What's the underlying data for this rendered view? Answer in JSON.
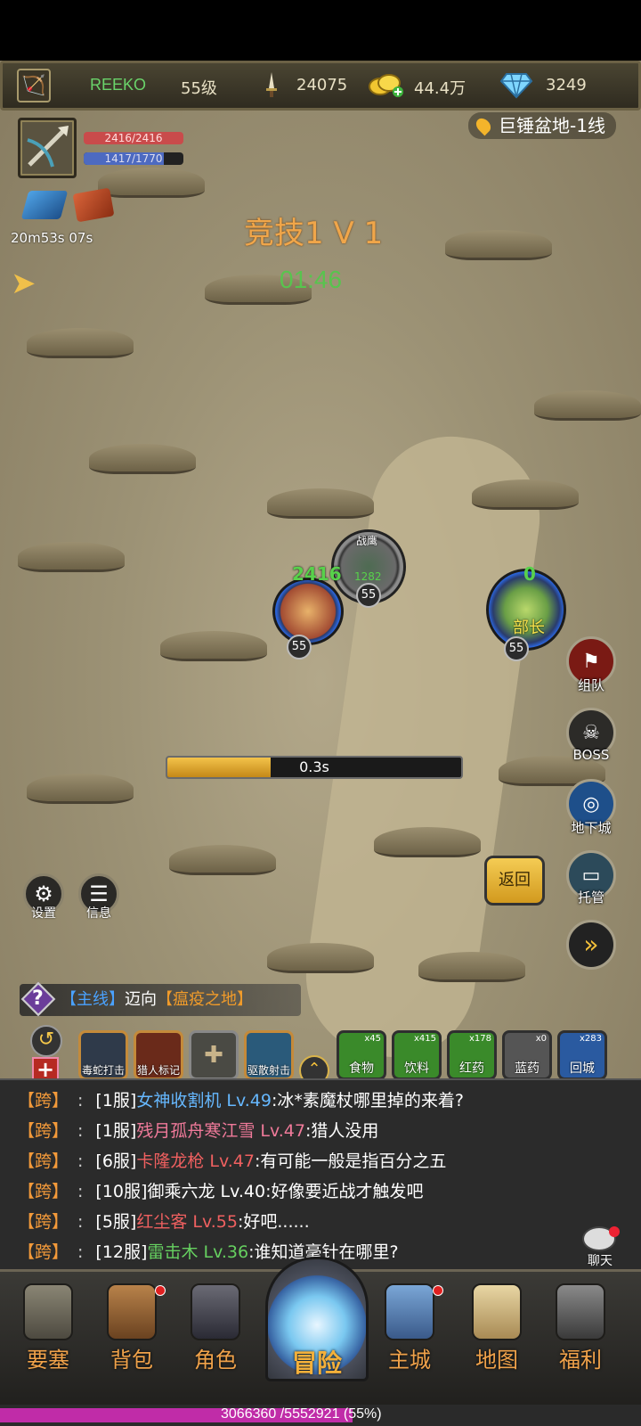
{
  "topbar": {
    "player_name": "REEKO",
    "level": "55级",
    "combat_power": "24075",
    "gold": "44.4万",
    "diamonds": "3249"
  },
  "player": {
    "hp": "2416/2416",
    "mp": "1417/1770",
    "mp_fraction": 0.8,
    "buff_timer": "20m53s 07s"
  },
  "location": "巨锤盆地-1线",
  "battle": {
    "mode_title": "竞技1 V 1",
    "countdown": "01:46",
    "player_hp_float": "2416",
    "player_level": "55",
    "pet_name": "战鹰",
    "pet_hp": "1282",
    "pet_level": "55",
    "enemy_hp_float": "0",
    "enemy_name": "部长",
    "enemy_level": "55",
    "cast_time": "0.3s",
    "cast_progress": 0.35
  },
  "side_buttons": {
    "team": "组队",
    "boss": "BOSS",
    "dungeon": "地下城",
    "return": "返回",
    "auto": "托管"
  },
  "left_buttons": {
    "settings": "设置",
    "info": "信息"
  },
  "quest": {
    "tag": "【主线】",
    "verb": "迈向",
    "target": "【瘟疫之地】"
  },
  "skills": [
    {
      "label": "毒蛇打击"
    },
    {
      "label": "猎人标记"
    },
    {
      "label": ""
    },
    {
      "label": "驱散射击"
    }
  ],
  "items": [
    {
      "count": "x45",
      "label": "食物",
      "color": "#3a8a2a"
    },
    {
      "count": "x415",
      "label": "饮料",
      "color": "#3a8a2a"
    },
    {
      "count": "x178",
      "label": "红药",
      "color": "#3a8a2a"
    },
    {
      "count": "x0",
      "label": "蓝药",
      "color": "#555555"
    },
    {
      "count": "x283",
      "label": "回城",
      "color": "#2a5aa0"
    }
  ],
  "chat": {
    "button_label": "聊天",
    "lines": [
      {
        "channel": "【跨】",
        "sep": ":",
        "server": "[1服]",
        "name": "女神收割机",
        "lv": "Lv.49",
        "msg": ":冰*素魔杖哪里掉的来着?"
      },
      {
        "channel": "【跨】",
        "sep": ":",
        "server": "[1服]",
        "name": "残月孤舟寒江雪",
        "lv": "Lv.47",
        "msg": ":猎人没用"
      },
      {
        "channel": "【跨】",
        "sep": ":",
        "server": "[6服]",
        "name": "卡隆龙枪",
        "lv": "Lv.47",
        "msg": ":有可能一般是指百分之五"
      },
      {
        "channel": "【跨】",
        "sep": ":",
        "server": "[10服]",
        "name": "御乘六龙",
        "lv": "Lv.40",
        "msg": ":好像要近战才触发吧"
      },
      {
        "channel": "【跨】",
        "sep": ":",
        "server": "[5服]",
        "name": "红尘客",
        "lv": "Lv.55",
        "msg": ":好吧......"
      },
      {
        "channel": "【跨】",
        "sep": ":",
        "server": "[12服]",
        "name": "雷击木",
        "lv": "Lv.36",
        "msg": ":谁知道毫针在哪里?"
      }
    ]
  },
  "nav": {
    "fortress": "要塞",
    "bag": "背包",
    "character": "角色",
    "adventure": "冒险",
    "main_city": "主城",
    "map": "地图",
    "welfare": "福利"
  },
  "exp": {
    "text": "3066360 /5552921 (55%)",
    "fraction": 0.55
  }
}
